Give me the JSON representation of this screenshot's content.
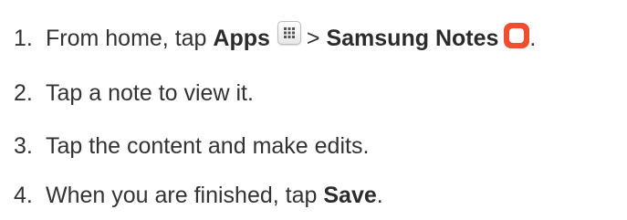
{
  "steps": [
    {
      "number": "1.",
      "text_before": "From home, tap",
      "bold_1": "Apps",
      "separator": ">",
      "bold_2": "Samsung Notes",
      "text_after": "."
    },
    {
      "number": "2.",
      "text": "Tap a note to view it."
    },
    {
      "number": "3.",
      "text": "Tap the content and make edits."
    },
    {
      "number": "4.",
      "text_before": "When you are finished, tap",
      "bold": "Save",
      "text_after": "."
    }
  ],
  "icons": {
    "apps": "apps-grid-icon",
    "notes": "samsung-notes-icon"
  },
  "colors": {
    "text": "#333333",
    "notes_icon": "#f04e2f"
  }
}
